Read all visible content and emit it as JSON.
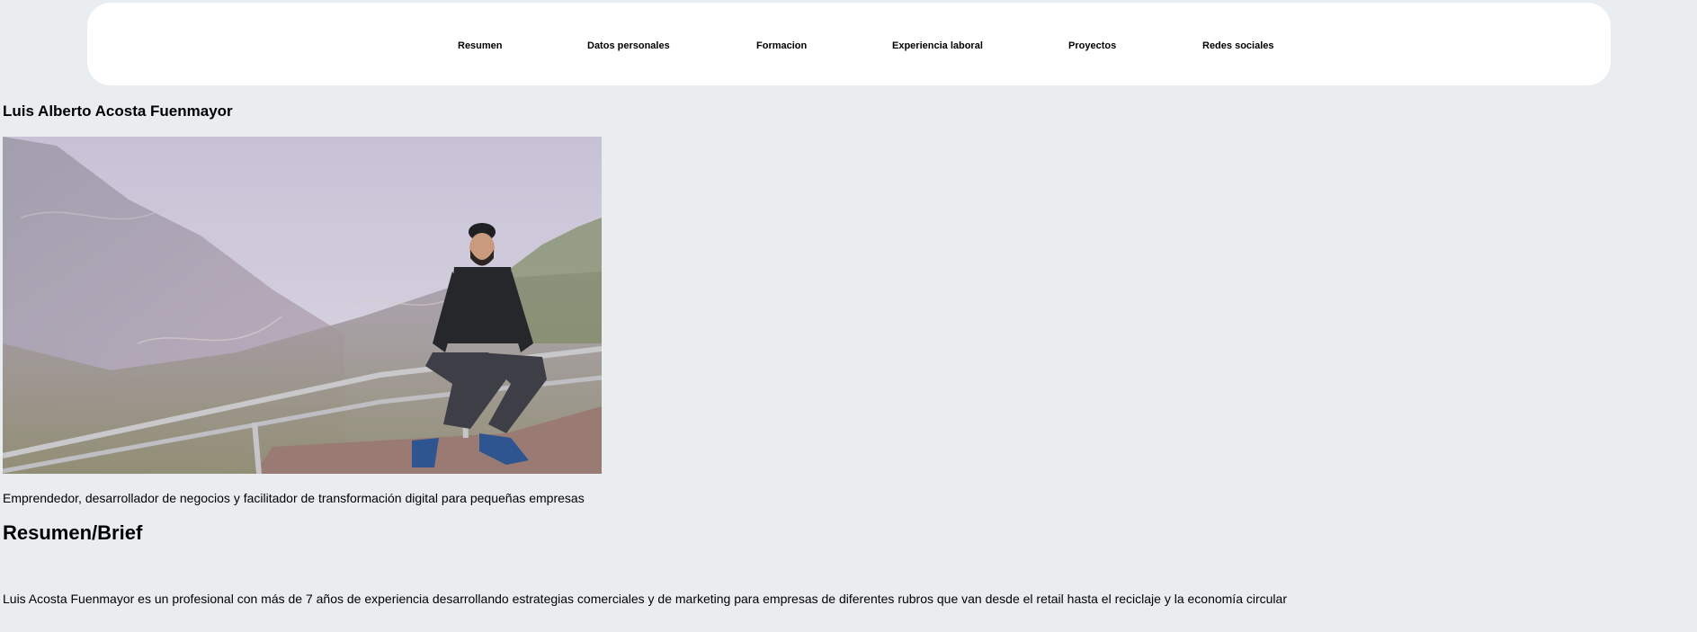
{
  "nav": {
    "items": [
      {
        "label": "Resumen"
      },
      {
        "label": "Datos personales"
      },
      {
        "label": "Formacion"
      },
      {
        "label": "Experiencia laboral"
      },
      {
        "label": "Proyectos"
      },
      {
        "label": "Redes sociales"
      }
    ]
  },
  "profile": {
    "name": "Luis Alberto Acosta Fuenmayor",
    "photo_alt": "Luis Alberto Acosta Fuenmayor",
    "tagline": "Emprendedor, desarrollador de negocios y facilitador de transformación digital para pequeñas empresas"
  },
  "summary": {
    "title": "Resumen/Brief",
    "text": "Luis Acosta Fuenmayor es un profesional con más de 7 años de experiencia desarrollando estrategias comerciales y de marketing para empresas de diferentes rubros que van desde el retail hasta el reciclaje y la economía circular"
  },
  "colors": {
    "page_background": "#e9edf0",
    "navbar_background": "#ffffff",
    "text": "#000000"
  }
}
